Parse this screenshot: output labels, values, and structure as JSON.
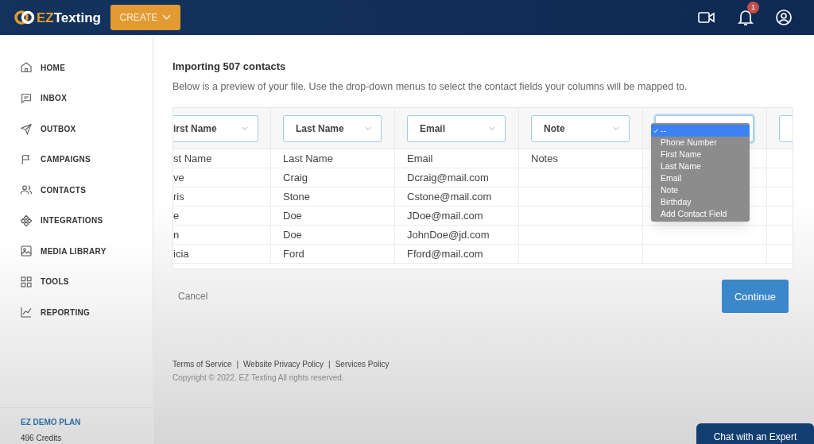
{
  "header": {
    "logo": {
      "accent": "EZ",
      "rest": "Texting"
    },
    "create_button": "CREATE",
    "notifications_badge": "1"
  },
  "sidebar": {
    "items": [
      {
        "label": "HOME"
      },
      {
        "label": "INBOX"
      },
      {
        "label": "OUTBOX"
      },
      {
        "label": "CAMPAIGNS"
      },
      {
        "label": "CONTACTS"
      },
      {
        "label": "INTEGRATIONS"
      },
      {
        "label": "MEDIA LIBRARY"
      },
      {
        "label": "TOOLS"
      },
      {
        "label": "REPORTING"
      }
    ],
    "plan": {
      "name": "EZ DEMO PLAN",
      "credits": "496 Credits"
    }
  },
  "import": {
    "title": "Importing 507 contacts",
    "description": "Below is a preview of your file. Use the drop-down menus to select the contact fields your columns will be mapped to."
  },
  "table": {
    "columns": [
      {
        "mapping": "irst Name",
        "header": "st Name"
      },
      {
        "mapping": "Last Name",
        "header": "Last Name"
      },
      {
        "mapping": "Email",
        "header": "Email"
      },
      {
        "mapping": "Note",
        "header": "Notes"
      },
      {
        "dropdown_open": true,
        "options": [
          {
            "label": "--",
            "selected": true
          },
          {
            "label": "Phone Number",
            "selected": false
          },
          {
            "label": "First Name",
            "selected": false
          },
          {
            "label": "Last Name",
            "selected": false
          },
          {
            "label": "Email",
            "selected": false
          },
          {
            "label": "Note",
            "selected": false
          },
          {
            "label": "Birthday",
            "selected": false
          },
          {
            "label": "Add Contact Field",
            "selected": false
          }
        ]
      },
      {
        "dropdown_open": false
      }
    ],
    "rows": [
      {
        "cells": [
          "ve",
          "Craig",
          "Dcraig@mail.com"
        ]
      },
      {
        "cells": [
          "ris",
          "Stone",
          "Cstone@mail.com"
        ]
      },
      {
        "cells": [
          "e",
          "Doe",
          "JDoe@mail.com"
        ]
      },
      {
        "cells": [
          "n",
          "Doe",
          "JohnDoe@jd.com"
        ]
      },
      {
        "cells": [
          "icia",
          "Ford",
          "Fford@mail.com"
        ]
      }
    ]
  },
  "actions": {
    "cancel": "Cancel",
    "continue": "Continue"
  },
  "footer": {
    "links": [
      "Terms of Service",
      "Website Privacy Policy",
      "Services Policy"
    ],
    "separator": "|",
    "copyright": "Copyright © 2022. EZ Texting All rights reserved."
  },
  "chat_button": "Chat with an Expert"
}
